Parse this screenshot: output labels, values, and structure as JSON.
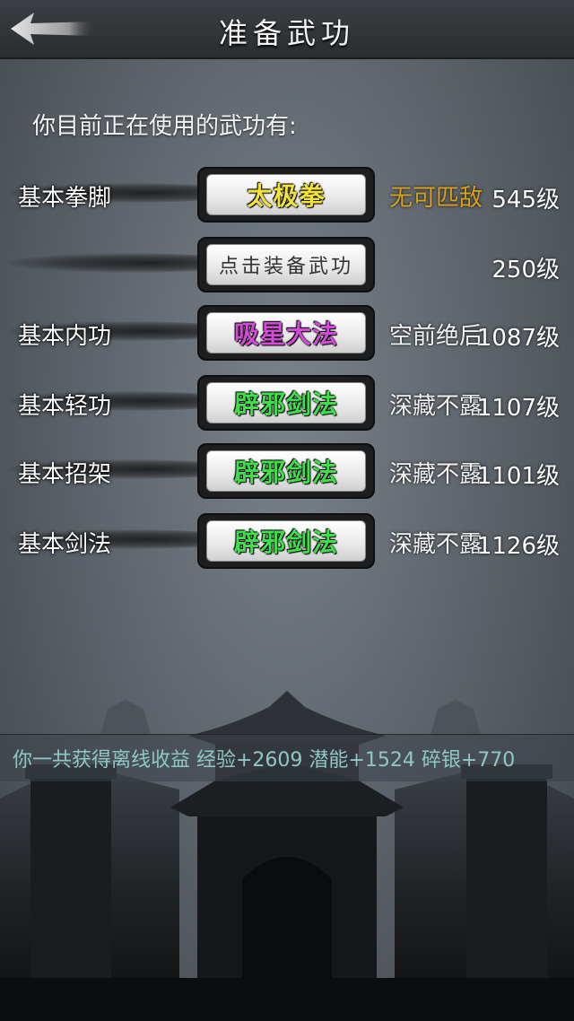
{
  "header": {
    "title": "准备武功"
  },
  "subtitle": "你目前正在使用的武功有:",
  "colors": {
    "yellow": "#f3e23a",
    "purple": "#d24bd6",
    "green": "#3ee04a",
    "gold": "#d9a01c"
  },
  "rows": [
    {
      "slot": "基本拳脚",
      "skill": "太极拳",
      "skill_color": "yellow",
      "rank": "无可匹敌",
      "rank_color": "#d9a01c",
      "level": "545级"
    },
    {
      "slot": "",
      "skill": "点击装备武功",
      "skill_color": "plain",
      "rank": "",
      "rank_color": "#ffffff",
      "level": "250级"
    },
    {
      "slot": "基本内功",
      "skill": "吸星大法",
      "skill_color": "purple",
      "rank": "空前绝后",
      "rank_color": "#ffffff",
      "level": "1087级"
    },
    {
      "slot": "基本轻功",
      "skill": "辟邪剑法",
      "skill_color": "green",
      "rank": "深藏不露",
      "rank_color": "#ffffff",
      "level": "1107级"
    },
    {
      "slot": "基本招架",
      "skill": "辟邪剑法",
      "skill_color": "green",
      "rank": "深藏不露",
      "rank_color": "#ffffff",
      "level": "1101级"
    },
    {
      "slot": "基本剑法",
      "skill": "辟邪剑法",
      "skill_color": "green",
      "rank": "深藏不露",
      "rank_color": "#ffffff",
      "level": "1126级"
    }
  ],
  "notice": "你一共获得离线收益 经验+2609 潜能+1524 碎银+770"
}
